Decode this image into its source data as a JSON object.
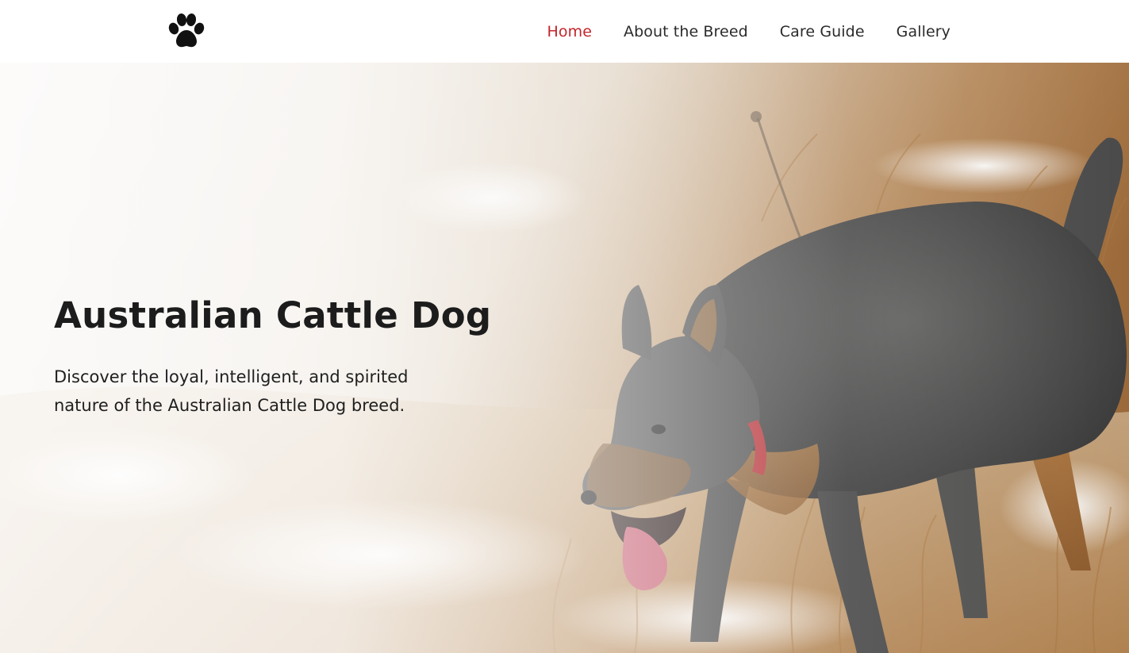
{
  "header": {
    "logo_icon": "paw-print-icon",
    "nav": {
      "home": "Home",
      "about": "About the Breed",
      "care": "Care Guide",
      "gallery": "Gallery"
    },
    "active_color": "#c3242c",
    "text_color": "#2b2b2b"
  },
  "hero": {
    "title": "Australian Cattle Dog",
    "subtitle": "Discover the loyal, intelligent, and spirited nature of the Australian Cattle Dog breed."
  }
}
